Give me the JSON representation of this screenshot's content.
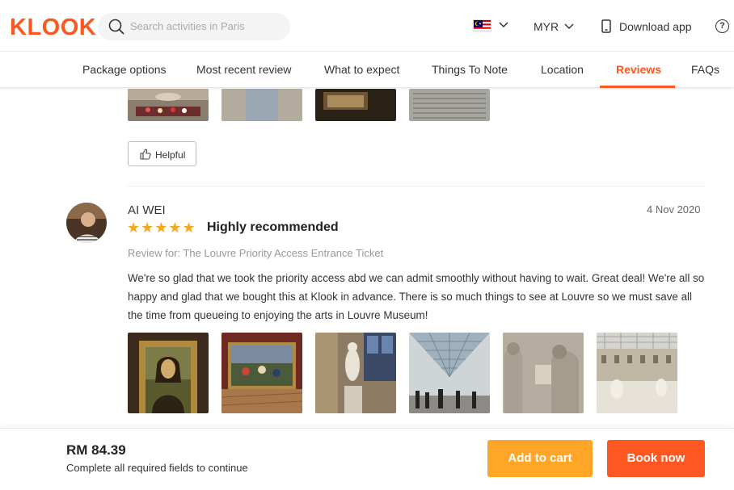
{
  "header": {
    "logo": "KLOOK",
    "search_placeholder": "Search activities in Paris",
    "currency": "MYR",
    "download_label": "Download app",
    "help_glyph": "?"
  },
  "nav": {
    "tabs": [
      {
        "label": "Package options",
        "active": false
      },
      {
        "label": "Most recent review",
        "active": false
      },
      {
        "label": "What to expect",
        "active": false
      },
      {
        "label": "Things To Note",
        "active": false
      },
      {
        "label": "Location",
        "active": false
      },
      {
        "label": "Reviews",
        "active": true
      },
      {
        "label": "FAQs",
        "active": false
      }
    ]
  },
  "previous_review": {
    "helpful_label": "Helpful"
  },
  "review": {
    "reviewer": "AI WEI",
    "date": "4 Nov 2020",
    "rating": 5,
    "stars": "★★★★★",
    "title": "Highly recommended",
    "review_for": "Review for: The Louvre Priority Access Entrance Ticket",
    "body": "We're so glad that we took the priority access abd we can admit smoothly without having to wait. Great deal! We're all so happy and glad that we bought this at Klook in advance. There is so much things to see at Louvre so we must save all the time from queueing to enjoying the arts in Louvre Museum!"
  },
  "booking": {
    "price": "RM 84.39",
    "hint": "Complete all required fields to continue",
    "add_to_cart": "Add to cart",
    "book_now": "Book now"
  },
  "colors": {
    "brand": "#ff5722",
    "cart": "#ffa628",
    "star": "#f5a623"
  }
}
